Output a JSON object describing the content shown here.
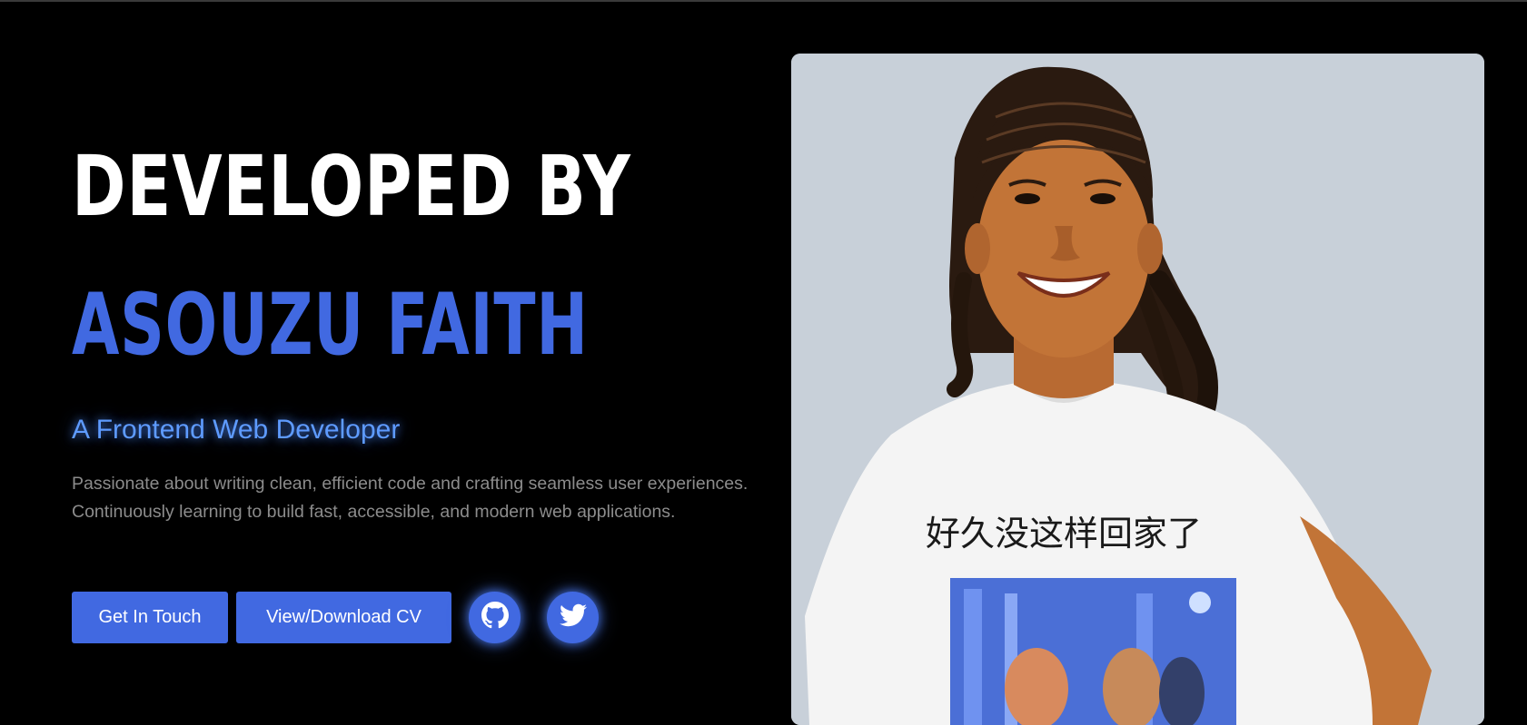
{
  "hero": {
    "headline_line1": "DEVELOPED BY",
    "headline_line2": "ASOUZU FAITH",
    "subtitle": "A Frontend Web Developer",
    "description_line1": "Passionate about writing clean, efficient code and crafting seamless user experiences.",
    "description_line2": "Continuously learning to build fast, accessible, and modern web applications."
  },
  "actions": {
    "contact_label": "Get In Touch",
    "cv_label": "View/Download CV",
    "github_icon": "github-icon",
    "twitter_icon": "twitter-icon"
  },
  "portrait": {
    "shirt_text": "好久没这样回家了"
  },
  "colors": {
    "background": "#000000",
    "accent": "#4169e1",
    "subtitle_glow": "#5e9bff",
    "body_text": "#8c8c8c",
    "photo_background": "#c8d0d9"
  }
}
